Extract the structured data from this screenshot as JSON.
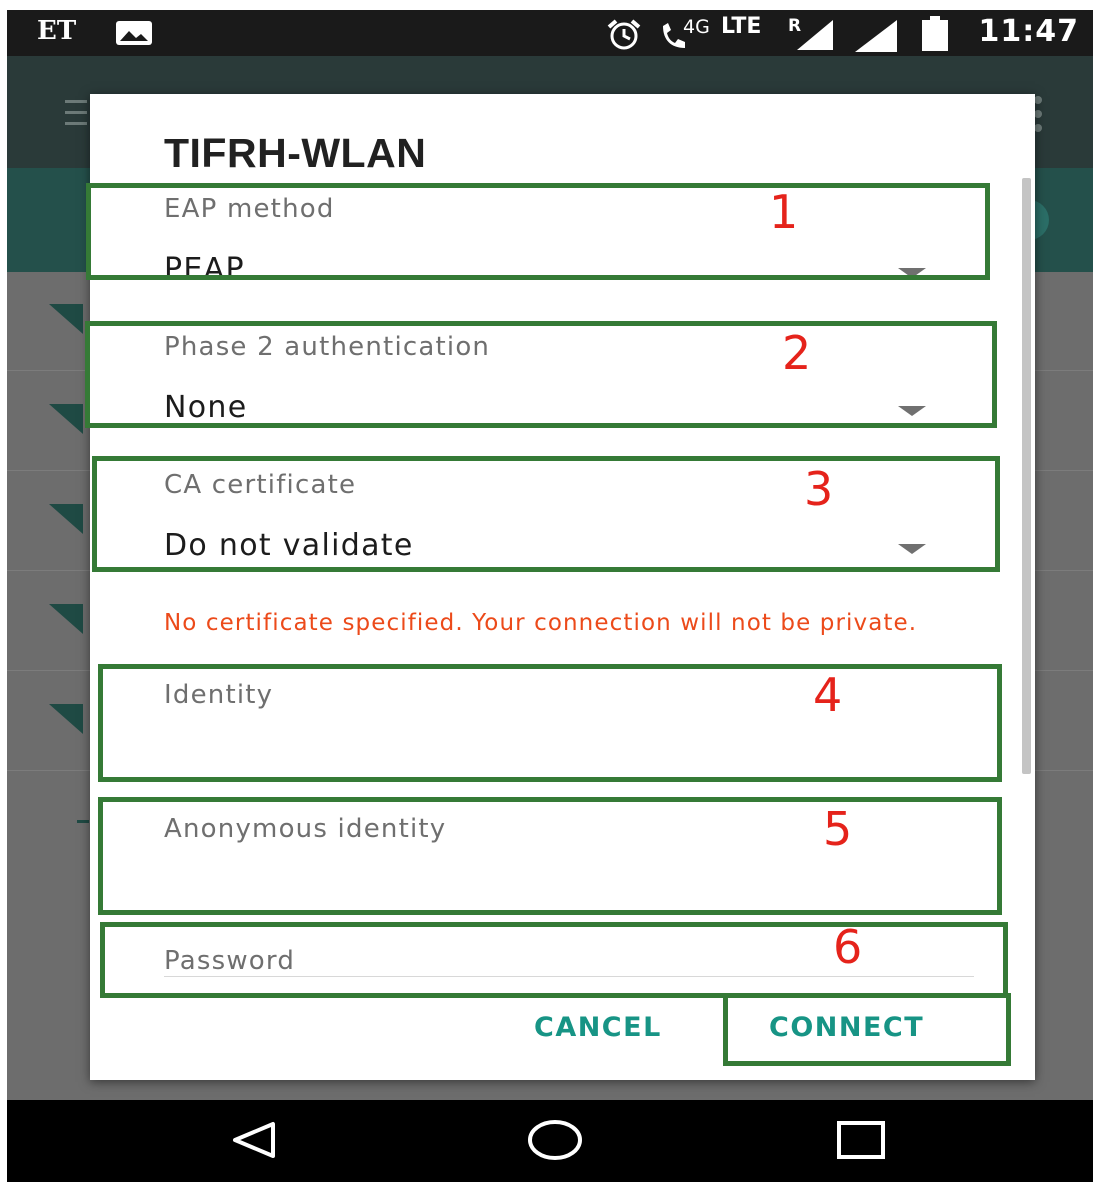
{
  "status_bar": {
    "carrier_logo": "ET",
    "time": "11:47",
    "network_4g": "4G",
    "network_lte": "LTE",
    "roaming": "R",
    "icons": [
      "gallery-icon",
      "alarm-icon",
      "wifi-calling-icon",
      "signal-icon",
      "signal-icon",
      "battery-icon"
    ]
  },
  "dialog": {
    "title": "TIFRH-WLAN",
    "eap_method": {
      "label": "EAP method",
      "value": "PEAP"
    },
    "phase2": {
      "label": "Phase 2 authentication",
      "value": "None"
    },
    "ca_certificate": {
      "label": "CA certificate",
      "value": "Do not validate"
    },
    "warning": "No certificate specified. Your connection will not be private.",
    "identity": {
      "placeholder": "Identity",
      "value": ""
    },
    "anonymous_identity": {
      "placeholder": "Anonymous identity",
      "value": ""
    },
    "password": {
      "placeholder": "Password",
      "value": ""
    },
    "cancel_label": "CANCEL",
    "connect_label": "CONNECT"
  },
  "annotations": [
    "1",
    "2",
    "3",
    "4",
    "5",
    "6"
  ],
  "colors": {
    "accent": "#179485",
    "warning": "#ec4a1a",
    "annotation_box": "#357a36",
    "annotation_number": "#e5231b"
  },
  "nav_bar": {
    "icons": [
      "back-icon",
      "home-icon",
      "recents-icon"
    ]
  }
}
